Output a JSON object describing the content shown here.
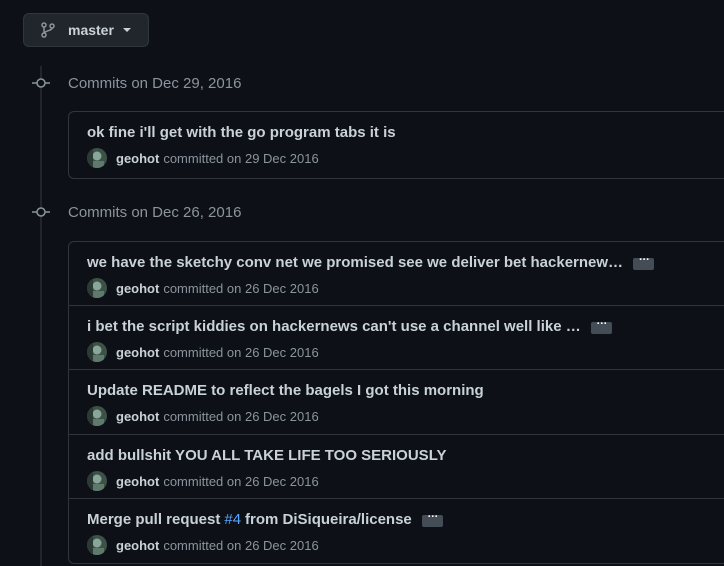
{
  "branch": {
    "label": "master",
    "icon": "git-branch-icon"
  },
  "groups": [
    {
      "title": "Commits on Dec 29, 2016",
      "commits": [
        {
          "message": "ok fine i'll get with the go program tabs it is",
          "author": "geohot",
          "committed_text": "committed on 29 Dec 2016"
        }
      ]
    },
    {
      "title": "Commits on Dec 26, 2016",
      "commits": [
        {
          "message": "we have the sketchy conv net we promised see we deliver bet hackernew…",
          "has_more": true,
          "author": "geohot",
          "committed_text": "committed on 26 Dec 2016"
        },
        {
          "message": "i bet the script kiddies on hackernews can't use a channel well like …",
          "has_more": true,
          "author": "geohot",
          "committed_text": "committed on 26 Dec 2016"
        },
        {
          "message": "Update README to reflect the bagels I got this morning",
          "author": "geohot",
          "committed_text": "committed on 26 Dec 2016"
        },
        {
          "message": "add bullshit YOU ALL TAKE LIFE TOO SERIOUSLY",
          "author": "geohot",
          "committed_text": "committed on 26 Dec 2016"
        },
        {
          "message_prefix": "Merge pull request",
          "pr_link": "#4",
          "message_suffix": "from DiSiqueira/license",
          "has_more": true,
          "author": "geohot",
          "committed_text": "committed on 26 Dec 2016"
        }
      ]
    }
  ],
  "ellipsis_label": "…",
  "colors": {
    "background": "#0d1117",
    "border": "#30363d",
    "link": "#58a6ff",
    "muted": "#8b949e",
    "text": "#c9d1d9"
  }
}
